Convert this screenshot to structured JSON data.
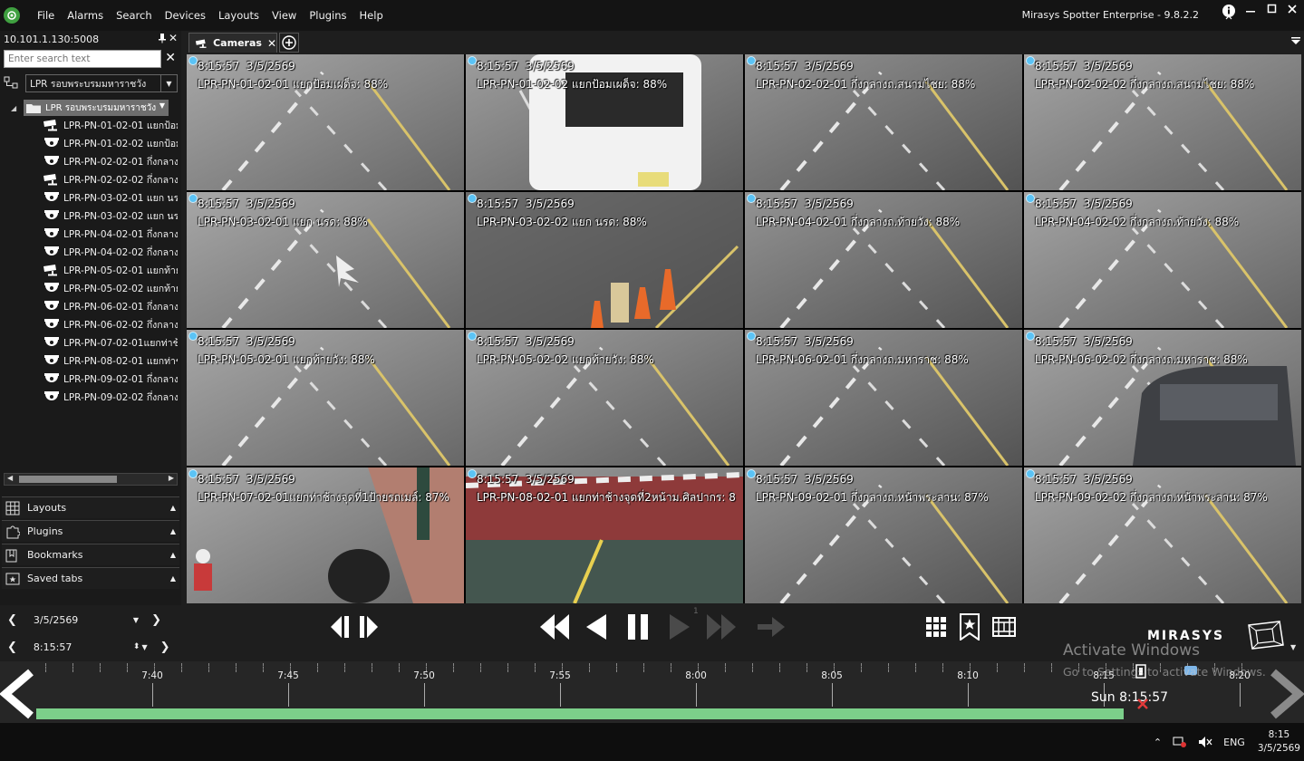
{
  "menubar": {
    "items": [
      "File",
      "Alarms",
      "Search",
      "Devices",
      "Layouts",
      "View",
      "Plugins",
      "Help"
    ],
    "app_title": "Mirasys Spotter Enterprise - 9.8.2.2"
  },
  "leftpanel": {
    "server": "10.101.1.130:5008",
    "search_placeholder": "Enter search text",
    "view_select": "LPR รอบพระบรมมหาราชวัง",
    "group_name": "LPR รอบพระบรมมหาราชวัง",
    "cameras": [
      {
        "label": "LPR-PN-01-02-01 แยกป้อม",
        "type": "bullet"
      },
      {
        "label": "LPR-PN-01-02-02 แยกป้อม",
        "type": "dome"
      },
      {
        "label": "LPR-PN-02-02-01 กึ่งกลางถ",
        "type": "dome"
      },
      {
        "label": "LPR-PN-02-02-02 กึ่งกลางถ",
        "type": "bullet"
      },
      {
        "label": "LPR-PN-03-02-01 แยก นรา",
        "type": "dome"
      },
      {
        "label": "LPR-PN-03-02-02 แยก นรา",
        "type": "dome"
      },
      {
        "label": "LPR-PN-04-02-01 กึ่งกลางถ",
        "type": "dome"
      },
      {
        "label": "LPR-PN-04-02-02 กึ่งกลางถ",
        "type": "dome"
      },
      {
        "label": "LPR-PN-05-02-01 แยกท้ายว",
        "type": "bullet"
      },
      {
        "label": "LPR-PN-05-02-02 แยกท้ายว",
        "type": "dome"
      },
      {
        "label": "LPR-PN-06-02-01 กึ่งกลางถ",
        "type": "dome"
      },
      {
        "label": "LPR-PN-06-02-02 กึ่งกลางถ",
        "type": "dome"
      },
      {
        "label": "LPR-PN-07-02-01แยกท่าช้",
        "type": "dome"
      },
      {
        "label": "LPR-PN-08-02-01 แยกท่าช้",
        "type": "dome"
      },
      {
        "label": "LPR-PN-09-02-01 กึ่งกลางถ",
        "type": "dome"
      },
      {
        "label": "LPR-PN-09-02-02 กึ่งกลางถ",
        "type": "dome"
      }
    ],
    "sections": [
      "Layouts",
      "Plugins",
      "Bookmarks",
      "Saved tabs"
    ]
  },
  "tabs": {
    "active": "Cameras"
  },
  "grid": {
    "timestamp": "8:15:57  3/5/2569",
    "tiles": [
      {
        "label": "LPR-PN-01-02-01 แยกป้อมเผด็จ: 88%",
        "scene": "road"
      },
      {
        "label": "LPR-PN-01-02-02 แยกป้อมเผด็จ: 88%",
        "scene": "van"
      },
      {
        "label": "LPR-PN-02-02-01 กึ่งกลางถ.สนามไชย: 88%",
        "scene": "road"
      },
      {
        "label": "LPR-PN-02-02-02 กึ่งกลางถ.สนามไชย: 88%",
        "scene": "road"
      },
      {
        "label": "LPR-PN-03-02-01 แยก นรด: 88%",
        "scene": "arrow"
      },
      {
        "label": "LPR-PN-03-02-02 แยก นรด: 88%",
        "scene": "cones"
      },
      {
        "label": "LPR-PN-04-02-01 กึ่งกลางถ.ท้ายวัง: 88%",
        "scene": "road"
      },
      {
        "label": "LPR-PN-04-02-02 กึ่งกลางถ.ท้ายวัง: 88%",
        "scene": "road"
      },
      {
        "label": "LPR-PN-05-02-01 แยกท้ายวัง: 88%",
        "scene": "road"
      },
      {
        "label": "LPR-PN-05-02-02 แยกท้ายวัง: 88%",
        "scene": "road"
      },
      {
        "label": "LPR-PN-06-02-01 กึ่งกลางถ.มหาราช: 88%",
        "scene": "road"
      },
      {
        "label": "LPR-PN-06-02-02 กึ่งกลางถ.มหาราช: 88%",
        "scene": "car"
      },
      {
        "label": "LPR-PN-07-02-01แยกท่าช้างจุดที่1ป้ายรถเมล์: 87%",
        "scene": "sidewalk"
      },
      {
        "label": "LPR-PN-08-02-01 แยกท่าช้างจุดที่2หน้าม.ศิลปากร: 8",
        "scene": "redlane"
      },
      {
        "label": "LPR-PN-09-02-01 กึ่งกลางถ.หน้าพระลาน: 87%",
        "scene": "road"
      },
      {
        "label": "LPR-PN-09-02-02 กึ่งกลางถ.หน้าพระลาน: 87%",
        "scene": "road"
      }
    ]
  },
  "playback": {
    "date": "3/5/2569",
    "time": "8:15:57",
    "speed_marker": "1"
  },
  "brand": {
    "logo_text": "MIRASYS"
  },
  "timeline": {
    "labels": [
      "7:40",
      "7:45",
      "7:50",
      "7:55",
      "8:00",
      "8:05",
      "8:10",
      "8:15",
      "8:20"
    ],
    "cursor_label": "Sun 8:15:57",
    "bar_color": "#7ccf8a"
  },
  "watermark": {
    "line1": "Activate Windows",
    "line2": "Go to Settings to activate Windows."
  },
  "taskbar": {
    "lang": "ENG",
    "clock_time": "8:15",
    "clock_date": "3/5/2569"
  },
  "colors": {
    "accent": "#5bc3f5",
    "logo_green": "#3fa040"
  }
}
